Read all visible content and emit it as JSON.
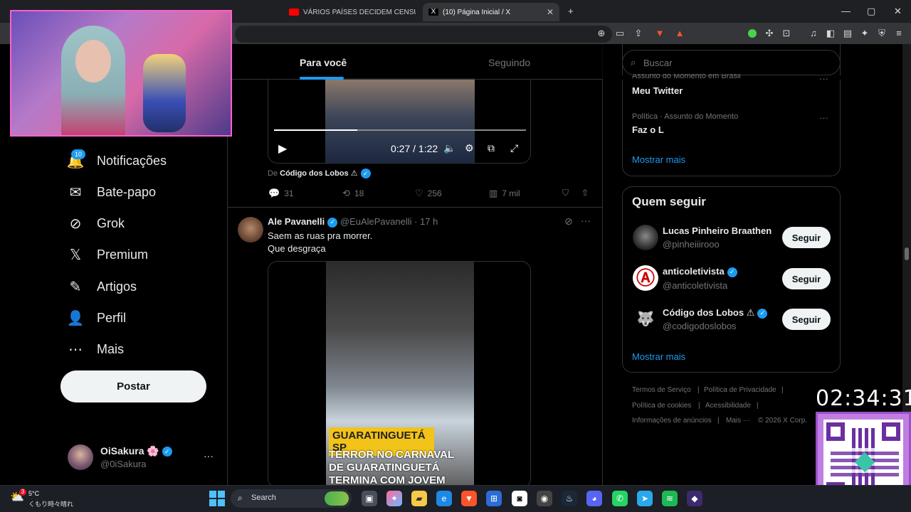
{
  "browser": {
    "tabs": [
      {
        "label": "VÁRIOS PAÍSES DECIDEM CENSURAR",
        "active": false
      },
      {
        "label": "(10) Página Inicial / X",
        "active": true
      }
    ],
    "new_tab": "+",
    "tab_close": "✕",
    "window_controls": [
      "—",
      "▢",
      "✕"
    ]
  },
  "left_nav": {
    "notifications_badge": "10",
    "items": [
      {
        "label": "Notificações",
        "icon": "bell-icon",
        "glyph": "🔔"
      },
      {
        "label": "Bate-papo",
        "icon": "envelope-icon",
        "glyph": "✉"
      },
      {
        "label": "Grok",
        "icon": "grok-icon",
        "glyph": "⊘"
      },
      {
        "label": "Premium",
        "icon": "x-logo-icon",
        "glyph": "𝕏"
      },
      {
        "label": "Artigos",
        "icon": "article-icon",
        "glyph": "✎"
      },
      {
        "label": "Perfil",
        "icon": "person-icon",
        "glyph": "👤"
      },
      {
        "label": "Mais",
        "icon": "more-circle-icon",
        "glyph": "⋯"
      }
    ],
    "post_button": "Postar",
    "account": {
      "name": "OiSakura 🌸",
      "handle": "@0iSakura",
      "more": "···"
    }
  },
  "feed": {
    "tabs": [
      "Para você",
      "Seguindo"
    ],
    "tweet1": {
      "video_time": "0:27 / 1:22",
      "video_progress": 0.33,
      "from_label": "De",
      "from_name": "Código dos Lobos ⚠",
      "replies": "31",
      "retweets": "18",
      "likes": "256",
      "views": "7 mil"
    },
    "tweet2": {
      "name": "Ale Pavanelli",
      "handle": "@EuAlePavanelli",
      "time": "· 17 h",
      "text_line1": "Saem as ruas pra morrer.",
      "text_line2": "Que desgraça",
      "media_caption_tag": "GUARATINGUETÁ SP",
      "media_caption": "TERROR NO CARNAVAL DE GUARATINGUETÁ TERMINA COM JOVEM MORTO E"
    }
  },
  "right_col": {
    "search_placeholder": "Buscar",
    "trends": [
      {
        "context": "Assunto do Momento em Brasil",
        "title": "Meu Twitter"
      },
      {
        "context": "Política · Assunto do Momento",
        "title": "Faz o L"
      }
    ],
    "show_more": "Mostrar mais",
    "who_to_follow": {
      "title": "Quem seguir",
      "accounts": [
        {
          "name": "Lucas Pinheiro Braathen",
          "handle": "@pinheiiirooo",
          "verified": false
        },
        {
          "name": "anticoletivista",
          "handle": "@anticoletivista",
          "verified": true
        },
        {
          "name": "Código dos Lobos ⚠",
          "handle": "@codigodoslobos",
          "verified": true
        }
      ],
      "follow_label": "Seguir",
      "show_more": "Mostrar mais"
    },
    "footer": {
      "row1": [
        "Termos de Serviço",
        "Política de Privacidade"
      ],
      "row2": [
        "Política de cookies",
        "Acessibilidade"
      ],
      "row3": [
        "Informações de anúncios",
        "Mais ···",
        "© 2026 X Corp."
      ]
    }
  },
  "overlay": {
    "clock": "02:34:31"
  },
  "taskbar": {
    "weather_temp": "5°C",
    "weather_desc": "くもり時々晴れ",
    "weather_badge": "3",
    "search_label": "Search"
  }
}
